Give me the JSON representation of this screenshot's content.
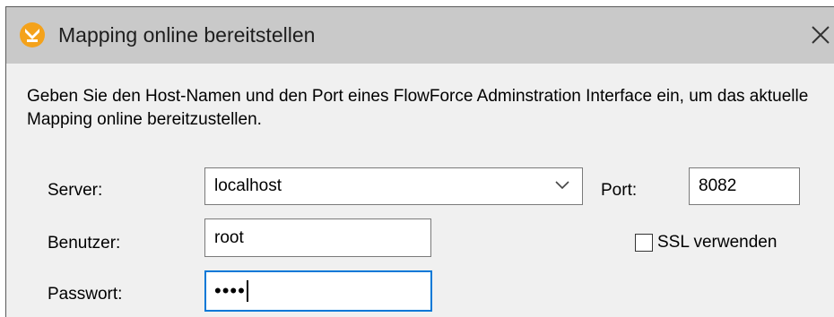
{
  "window": {
    "title": "Mapping online bereitstellen",
    "icon": "mapforce-app-icon",
    "close_icon": "close-icon"
  },
  "description": "Geben Sie den Host-Namen und den Port eines FlowForce Adminstration Interface ein, um das aktuelle Mapping online bereitzustellen.",
  "form": {
    "server_label": "Server:",
    "server_value": "localhost",
    "port_label": "Port:",
    "port_value": "8082",
    "user_label": "Benutzer:",
    "user_value": "root",
    "ssl_label": "SSL verwenden",
    "ssl_checked": false,
    "password_label": "Passwort:",
    "password_value": "••••"
  },
  "colors": {
    "titlebar": "#c9c9c9",
    "background": "#f0f0f0",
    "focus_border": "#0078d7",
    "icon_orange": "#f4a21b"
  }
}
